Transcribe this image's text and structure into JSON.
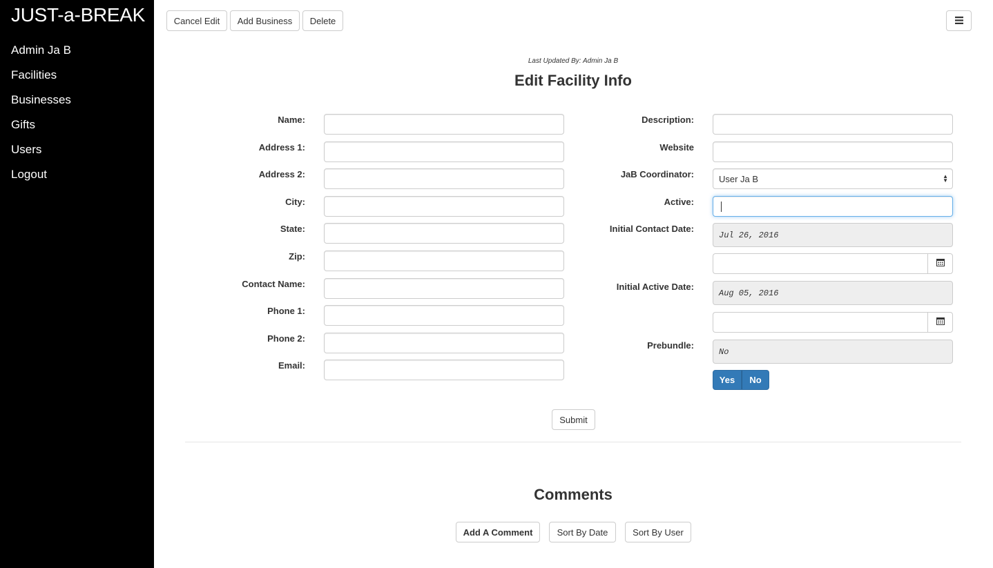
{
  "app": {
    "brand": "JUST-a-BREAK"
  },
  "sidebar": {
    "items": [
      {
        "label": "Admin Ja B"
      },
      {
        "label": "Facilities"
      },
      {
        "label": "Businesses"
      },
      {
        "label": "Gifts"
      },
      {
        "label": "Users"
      },
      {
        "label": "Logout"
      }
    ]
  },
  "toolbar": {
    "cancel_edit": "Cancel Edit",
    "add_business": "Add Business",
    "delete": "Delete",
    "menu_icon": "hamburger-menu-icon"
  },
  "page": {
    "last_updated": "Last Updated By: Admin Ja B",
    "title": "Edit Facility Info"
  },
  "form": {
    "left_fields": [
      {
        "label": "Name:",
        "value": ""
      },
      {
        "label": "Address 1:",
        "value": ""
      },
      {
        "label": "Address 2:",
        "value": ""
      },
      {
        "label": "City:",
        "value": ""
      },
      {
        "label": "State:",
        "value": ""
      },
      {
        "label": "Zip:",
        "value": ""
      },
      {
        "label": "Contact Name:",
        "value": ""
      },
      {
        "label": "Phone 1:",
        "value": ""
      },
      {
        "label": "Phone 2:",
        "value": ""
      },
      {
        "label": "Email:",
        "value": ""
      }
    ],
    "description_label": "Description:",
    "website_label": "Website",
    "coordinator_label": "JaB Coordinator:",
    "coordinator_value": "User Ja B",
    "active_label": "Active:",
    "initial_contact_label": "Initial Contact Date:",
    "initial_contact_value": "Jul 26, 2016",
    "initial_active_label": "Initial Active Date:",
    "initial_active_value": "Aug 05, 2016",
    "prebundle_label": "Prebundle:",
    "prebundle_value": "No",
    "toggle_yes": "Yes",
    "toggle_no": "No",
    "calendar_icon": "calendar-icon",
    "submit": "Submit"
  },
  "comments": {
    "title": "Comments",
    "add": "Add A Comment",
    "sort_date": "Sort By Date",
    "sort_user": "Sort By User"
  }
}
